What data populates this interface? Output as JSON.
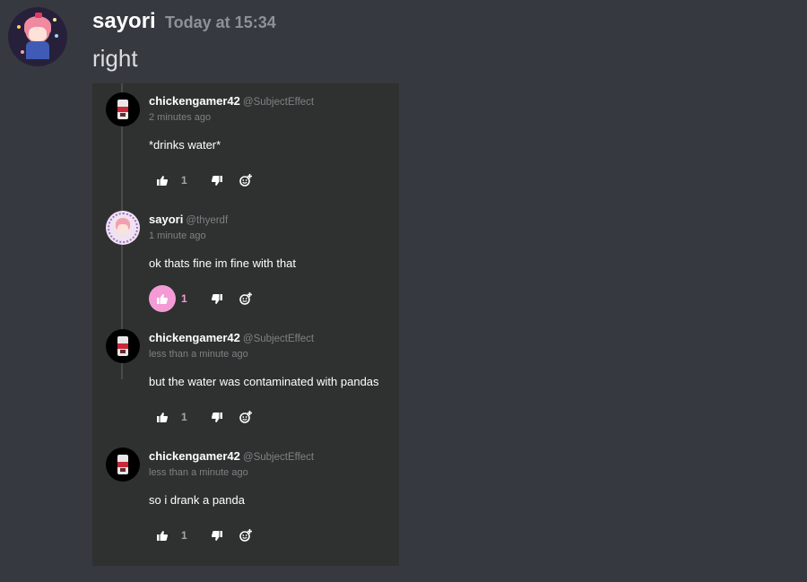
{
  "message": {
    "author": "sayori",
    "timestamp": "Today at 15:34",
    "content": "right"
  },
  "comments": [
    {
      "name": "chickengamer42",
      "handle": "@SubjectEffect",
      "time": "2 minutes ago",
      "text": "*drinks water*",
      "likes": "1",
      "liked": false,
      "avatar": "soda-can-avatar"
    },
    {
      "name": "sayori",
      "handle": "@thyerdf",
      "time": "1 minute ago",
      "text": "ok thats fine im fine with that",
      "likes": "1",
      "liked": true,
      "avatar": "anime-girl-avatar"
    },
    {
      "name": "chickengamer42",
      "handle": "@SubjectEffect",
      "time": "less than a minute ago",
      "text": "but the water was contaminated with pandas",
      "likes": "1",
      "liked": false,
      "avatar": "soda-can-avatar"
    },
    {
      "name": "chickengamer42",
      "handle": "@SubjectEffect",
      "time": "less than a minute ago",
      "text": "so i drank a panda",
      "likes": "1",
      "liked": false,
      "avatar": "soda-can-avatar"
    }
  ],
  "colors": {
    "background": "#36393f",
    "embed": "#2f3030",
    "like_active": "#f49bd6"
  },
  "icons": [
    "thumbs-up-icon",
    "thumbs-down-icon",
    "add-reaction-icon"
  ]
}
